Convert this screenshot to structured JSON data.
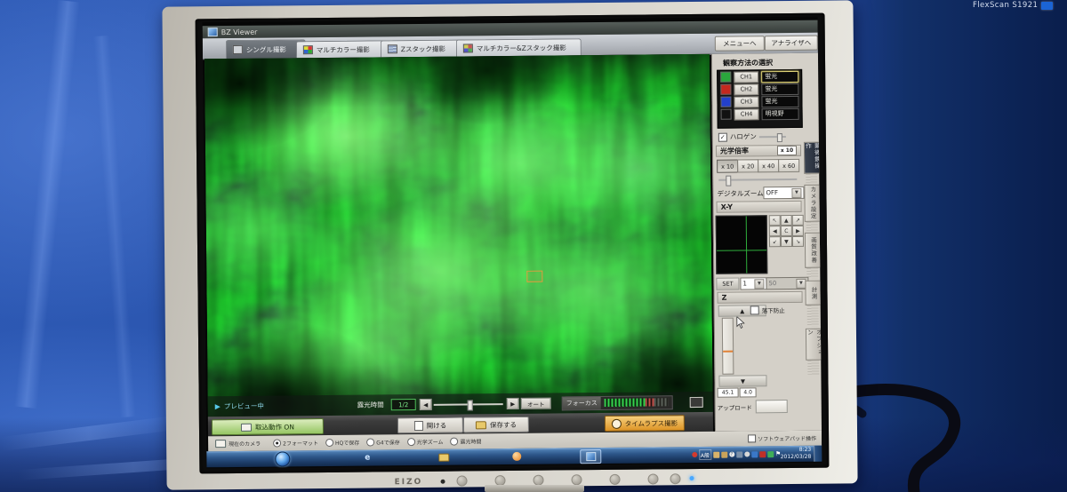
{
  "monitor": {
    "brand": "EIZO",
    "model": "FlexScan S1921"
  },
  "colors": {
    "backdrop_blue": "#2a55ae",
    "fluorescence_green": "#46c44e",
    "timelapse_orange": "#e8a23a",
    "capture_green": "#95c562",
    "preview_cyan": "#8fd9ec",
    "channel_ch1": "#2aa63c",
    "channel_ch2": "#c4281e",
    "channel_ch3": "#2340cc",
    "channel_ch4": "#111111"
  },
  "icons": {
    "play": "▶",
    "left": "◀",
    "right": "▶",
    "up": "▲",
    "down": "▼",
    "nw": "↖",
    "ne": "↗",
    "center": "C",
    "sw": "↙",
    "se": "↘",
    "dropdown": "▼",
    "check": "✓",
    "ie": "e",
    "flag": "⚑"
  },
  "app": {
    "window_title": "BZ Viewer",
    "tabs": [
      {
        "label": "シングル撮影",
        "active": true
      },
      {
        "label": "マルチカラー撮影",
        "active": false
      },
      {
        "label": "Zスタック撮影",
        "active": false
      },
      {
        "label": "マルチカラー&Zスタック撮影",
        "active": false
      }
    ],
    "nav_buttons": [
      {
        "label": "メニューへ"
      },
      {
        "label": "アナライザへ"
      }
    ]
  },
  "preview_bar": {
    "status": "プレビュー中",
    "exposure_label": "露光時間",
    "exposure_value": "1/2",
    "auto_label": "オート",
    "focus_label": "フォーカス"
  },
  "right_panel": {
    "observation_title": "観察方法の選択",
    "channels": [
      {
        "id": "CH1",
        "value": "蛍光",
        "selected": true
      },
      {
        "id": "CH2",
        "value": "蛍光",
        "selected": false
      },
      {
        "id": "CH3",
        "value": "蛍光",
        "selected": false
      },
      {
        "id": "CH4",
        "value": "明視野",
        "selected": false
      }
    ],
    "halogen_label": "ハロゲン",
    "magnification": {
      "title": "光学倍率",
      "current": "x 10",
      "options": [
        "x 10",
        "x 20",
        "x 40",
        "x 60"
      ]
    },
    "digital_zoom_label": "デジタルズーム",
    "digital_zoom_value": "OFF",
    "xy": {
      "title": "X-Y",
      "set_label": "SET",
      "index_value": "1",
      "step_value": "50"
    },
    "z": {
      "title": "Z",
      "safety_checkbox": "落下防止",
      "position_value": "45.1",
      "pitch_value": "4.0",
      "upload_label": "アップロード"
    },
    "software_checkbox": "ソフトウェアパッド操作",
    "side_tabs": [
      {
        "label": "顕微鏡操作",
        "active": true
      },
      {
        "label": "カメラ設定",
        "active": false
      },
      {
        "label": "画質改善",
        "active": false
      },
      {
        "label": "計測",
        "active": false
      },
      {
        "label": "オプション",
        "active": false
      }
    ]
  },
  "action_bar": {
    "capture_toggle": "取込動作 ON",
    "open_button": "開ける",
    "save_button": "保存する",
    "timelapse_button": "タイムラプス撮影"
  },
  "options_row": {
    "camera_label": "現在のカメラ",
    "radios": [
      {
        "label": "2フォーマット",
        "selected": true
      },
      {
        "label": "HQで保存",
        "selected": false
      },
      {
        "label": "G4で保存",
        "selected": false
      },
      {
        "label": "光学ズーム",
        "selected": false
      },
      {
        "label": "露光時間",
        "selected": false
      }
    ]
  },
  "taskbar": {
    "ime": "A般",
    "time": "8:23",
    "date": "2012/03/28"
  }
}
